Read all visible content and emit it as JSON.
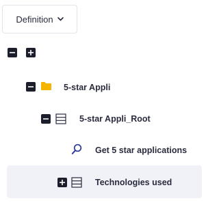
{
  "toolbar": {
    "view_select_value": "Definition"
  },
  "tree": {
    "root_controls": {
      "collapse_icon": "minus-square-icon",
      "expand_icon": "plus-square-icon"
    },
    "nodes": [
      {
        "label": "5-star Appli",
        "icon": "folder-icon",
        "state": "expanded",
        "level": 1
      },
      {
        "label": "5-star Appli_Root",
        "icon": "table-icon",
        "state": "expanded",
        "level": 2
      },
      {
        "label": "Get 5 star applications",
        "icon": "search-icon",
        "state": "leaf",
        "level": 3
      },
      {
        "label": "Technologies used",
        "icon": "table-icon",
        "state": "collapsed",
        "level": 3,
        "selected": true
      }
    ]
  },
  "colors": {
    "folder": "#f5b400",
    "accent": "#2c3a9b",
    "selected_bg": "#f1f2f8",
    "text": "#2a2b3d"
  }
}
